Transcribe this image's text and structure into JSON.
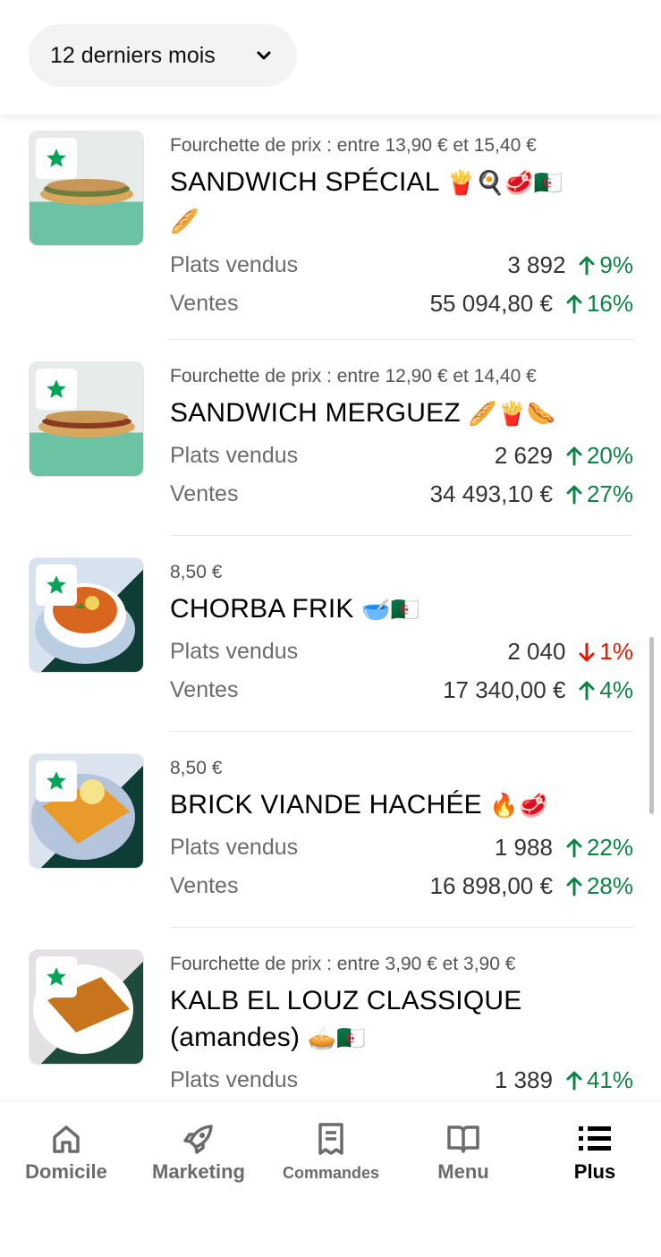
{
  "filter": {
    "period_label": "12 derniers mois",
    "chevron_icon": "chevron-down-icon"
  },
  "colors": {
    "accent_green": "#0e8345",
    "negative_red": "#e11900",
    "star_green": "#05a357"
  },
  "items": [
    {
      "price": "Fourchette de prix : entre 13,90 € et 15,40 €",
      "name": "SANDWICH SPÉCIAL",
      "emojis": "🍟🍳🥩🇩🇿",
      "name_line2_emoji": "🥖",
      "sold_label": "Plats vendus",
      "sold_value": "3 892",
      "sold_delta": "9%",
      "sold_trend": "up",
      "sales_label": "Ventes",
      "sales_value": "55 094,80 €",
      "sales_delta": "16%",
      "sales_trend": "up",
      "image_icon": "sandwich-photo"
    },
    {
      "price": "Fourchette de prix : entre 12,90 € et 14,40 €",
      "name": "SANDWICH MERGUEZ",
      "emojis": "🥖🍟🌭",
      "sold_label": "Plats vendus",
      "sold_value": "2 629",
      "sold_delta": "20%",
      "sold_trend": "up",
      "sales_label": "Ventes",
      "sales_value": "34 493,10 €",
      "sales_delta": "27%",
      "sales_trend": "up",
      "image_icon": "sandwich-photo"
    },
    {
      "price": "8,50 €",
      "name": "CHORBA FRIK",
      "emojis": "🥣🇩🇿",
      "sold_label": "Plats vendus",
      "sold_value": "2 040",
      "sold_delta": "1%",
      "sold_trend": "down",
      "sales_label": "Ventes",
      "sales_value": "17 340,00 €",
      "sales_delta": "4%",
      "sales_trend": "up",
      "image_icon": "soup-photo"
    },
    {
      "price": "8,50 €",
      "name": "BRICK VIANDE HACHÉE",
      "emojis": "🔥🥩",
      "sold_label": "Plats vendus",
      "sold_value": "1 988",
      "sold_delta": "22%",
      "sold_trend": "up",
      "sales_label": "Ventes",
      "sales_value": "16 898,00 €",
      "sales_delta": "28%",
      "sales_trend": "up",
      "image_icon": "brick-photo"
    },
    {
      "price": "Fourchette de prix : entre 3,90 € et 3,90 €",
      "name": "KALB EL LOUZ CLASSIQUE",
      "name_line2": "(amandes)",
      "emojis": "🥧🇩🇿",
      "sold_label": "Plats vendus",
      "sold_value": "1 389",
      "sold_delta": "41%",
      "sold_trend": "up",
      "image_icon": "cake-photo"
    }
  ],
  "nav": [
    {
      "label": "Domicile",
      "icon": "home-icon"
    },
    {
      "label": "Marketing",
      "icon": "rocket-icon"
    },
    {
      "label": "Commandes",
      "icon": "receipt-icon"
    },
    {
      "label": "Menu",
      "icon": "book-icon"
    },
    {
      "label": "Plus",
      "icon": "list-icon",
      "active": true
    }
  ]
}
